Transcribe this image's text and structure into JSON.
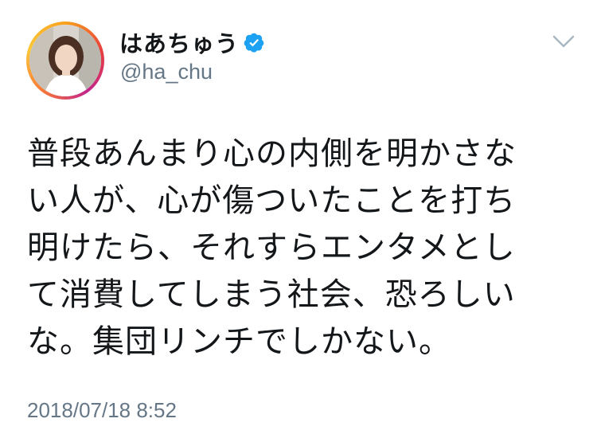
{
  "user": {
    "display_name": "はあちゅう",
    "handle": "@ha_chu",
    "verified": true,
    "avatar_icon": "profile-photo",
    "ring_colors": [
      "#f9a11b",
      "#e8413c",
      "#c2258c",
      "#fcc838"
    ]
  },
  "tweet": {
    "text": "普段あんまり心の内側を明かさな\nい人が、心が傷ついたことを打ち\n明けたら、それすらエンタメとし\nて消費してしまう社会、恐ろしい\nな。集団リンチでしかない。",
    "timestamp": "2018/07/18 8:52"
  },
  "menu": {
    "icon": "chevron-down-icon"
  },
  "colors": {
    "text": "#14171a",
    "secondary": "#657786",
    "verified": "#1da1f2"
  }
}
